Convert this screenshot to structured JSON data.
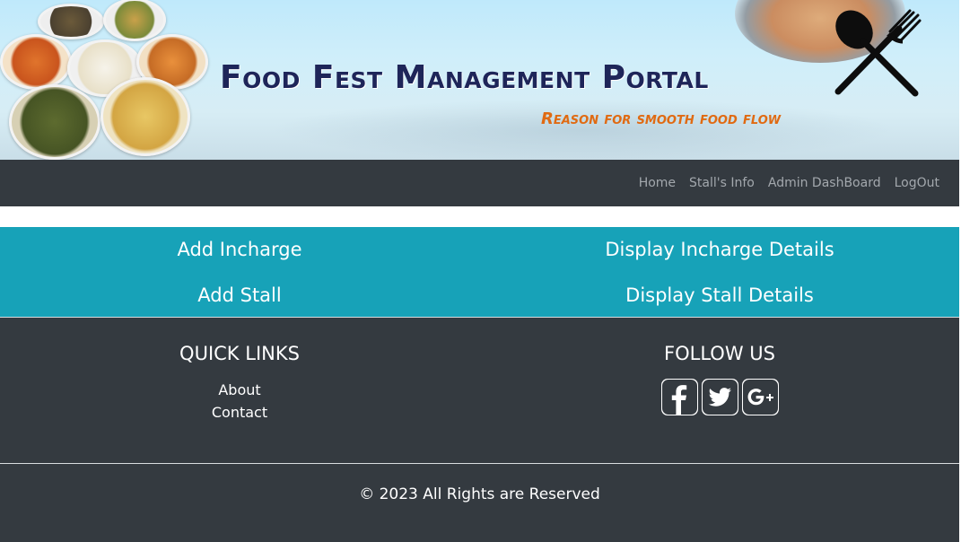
{
  "banner": {
    "title": "Food Fest Management Portal",
    "tagline": "Reason for smooth food flow",
    "icons": [
      "food-dishes-image",
      "spoon-fork-icon"
    ]
  },
  "nav": {
    "items": [
      {
        "label": "Home"
      },
      {
        "label": "Stall's Info"
      },
      {
        "label": "Admin DashBoard"
      },
      {
        "label": "LogOut"
      }
    ]
  },
  "actions": {
    "add_incharge": "Add Incharge",
    "display_incharge": "Display Incharge Details",
    "add_stall": "Add Stall",
    "display_stall": "Display Stall Details"
  },
  "footer": {
    "quick_links_heading": "QUICK LINKS",
    "links": [
      {
        "label": "About"
      },
      {
        "label": "Contact"
      }
    ],
    "follow_heading": "FOLLOW US",
    "social": [
      {
        "icon": "facebook-icon"
      },
      {
        "icon": "twitter-icon"
      },
      {
        "icon": "google-plus-icon"
      }
    ],
    "copyright": "© 2023 All Rights are Reserved"
  },
  "colors": {
    "navbar": "#343a40",
    "accent": "#17a2b8",
    "title": "#1e2559",
    "tagline": "#e06a12",
    "nav_link": "#a3a8ad"
  }
}
